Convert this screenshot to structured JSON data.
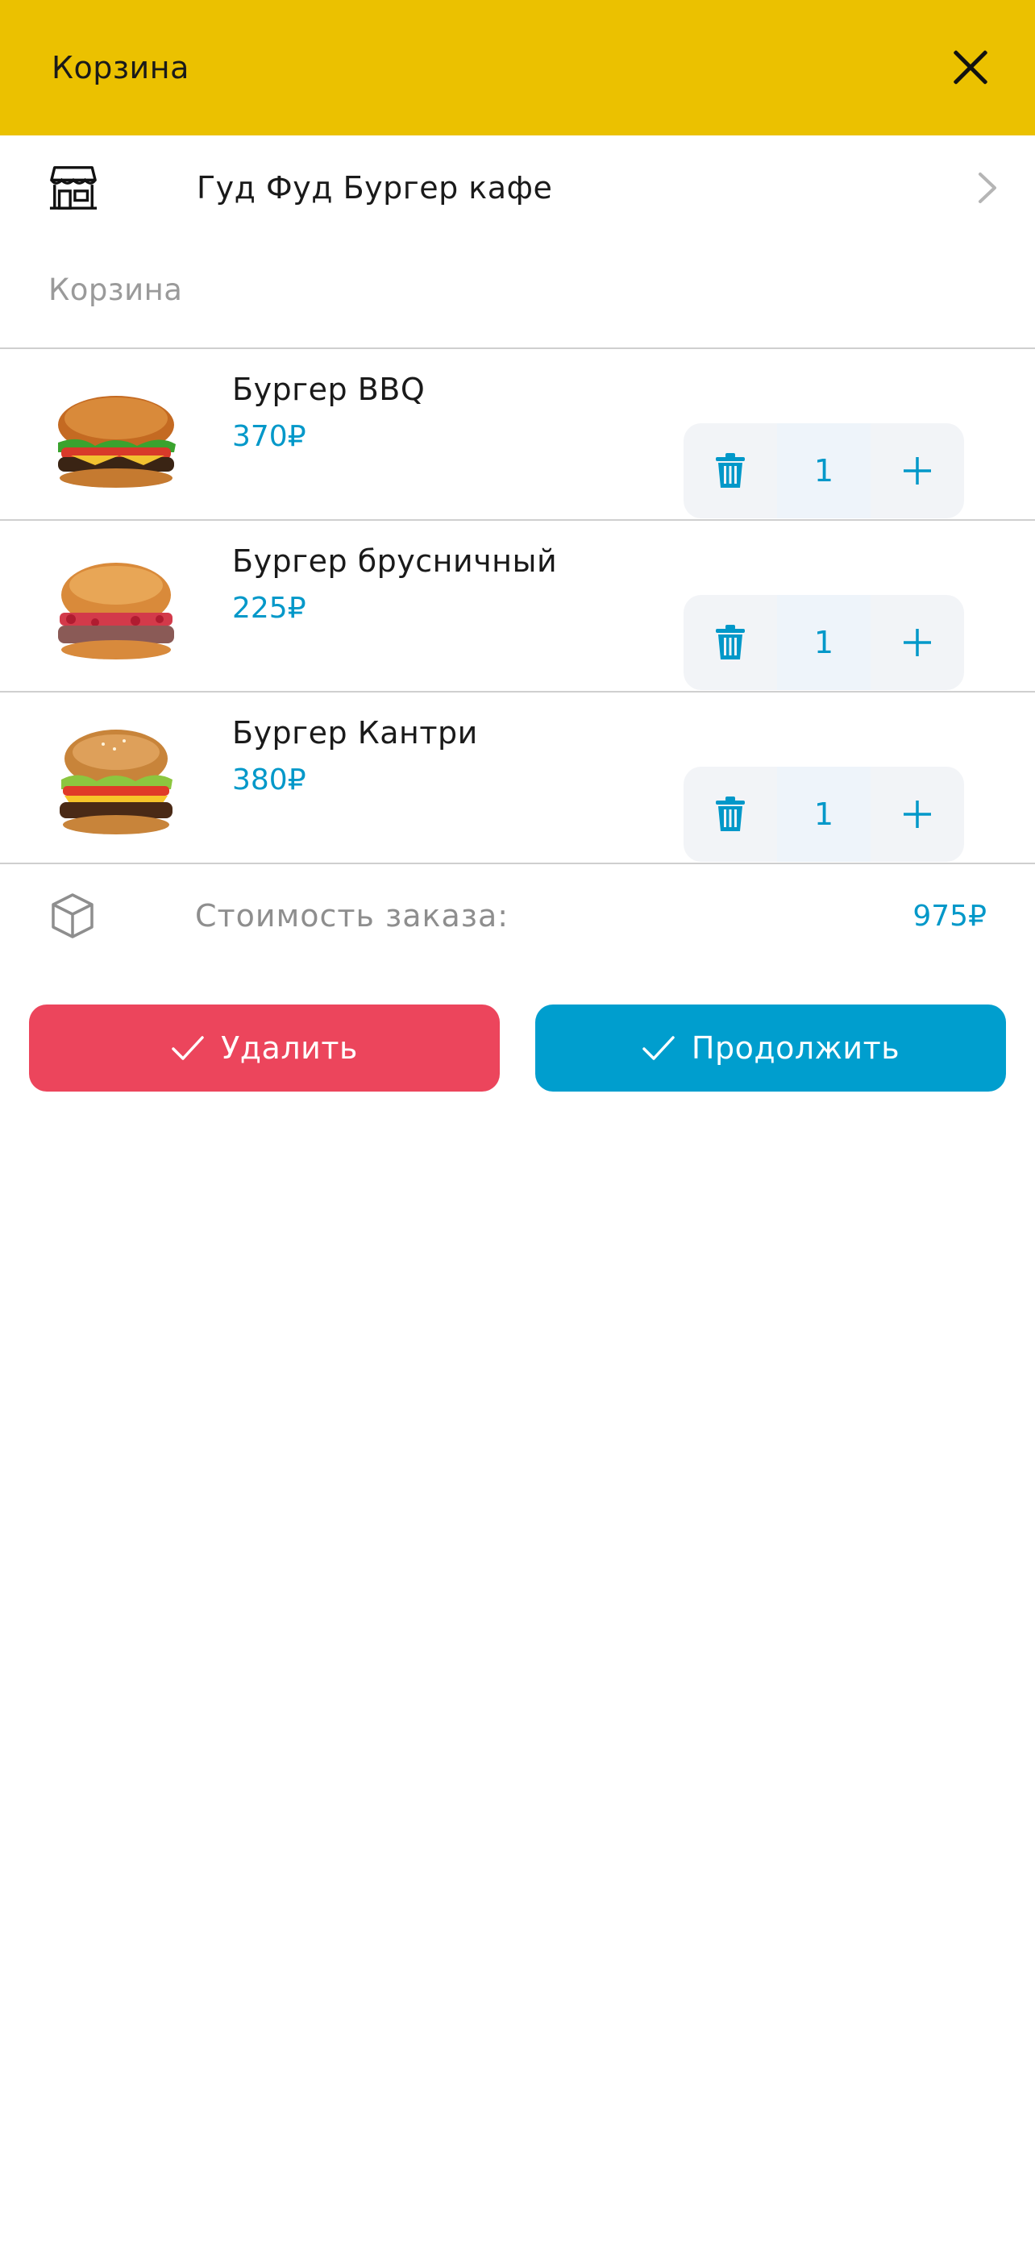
{
  "header": {
    "title": "Корзина",
    "close_icon": "close-icon",
    "bg_color": "#EBC100"
  },
  "restaurant": {
    "name": "Гуд Фуд Бургер кафе",
    "icon": "store-icon",
    "chevron": "chevron-right-icon"
  },
  "cart": {
    "section_label": "Корзина",
    "items": [
      {
        "name": "Бургер BBQ",
        "price": "370₽",
        "quantity": "1",
        "image": "burger-bbq-image"
      },
      {
        "name": "Бургер брусничный",
        "price": "225₽",
        "quantity": "1",
        "image": "burger-lingonberry-image"
      },
      {
        "name": "Бургер Кантри",
        "price": "380₽",
        "quantity": "1",
        "image": "burger-country-image"
      }
    ]
  },
  "summary": {
    "label": "Стоимость заказа:",
    "total": "975₽",
    "icon": "box-icon"
  },
  "actions": {
    "delete_label": "Удалить",
    "continue_label": "Продолжить",
    "delete_color": "#EC455C",
    "continue_color": "#009ECE"
  },
  "colors": {
    "accent": "#0198C9",
    "muted_text": "#9A9A9A"
  }
}
